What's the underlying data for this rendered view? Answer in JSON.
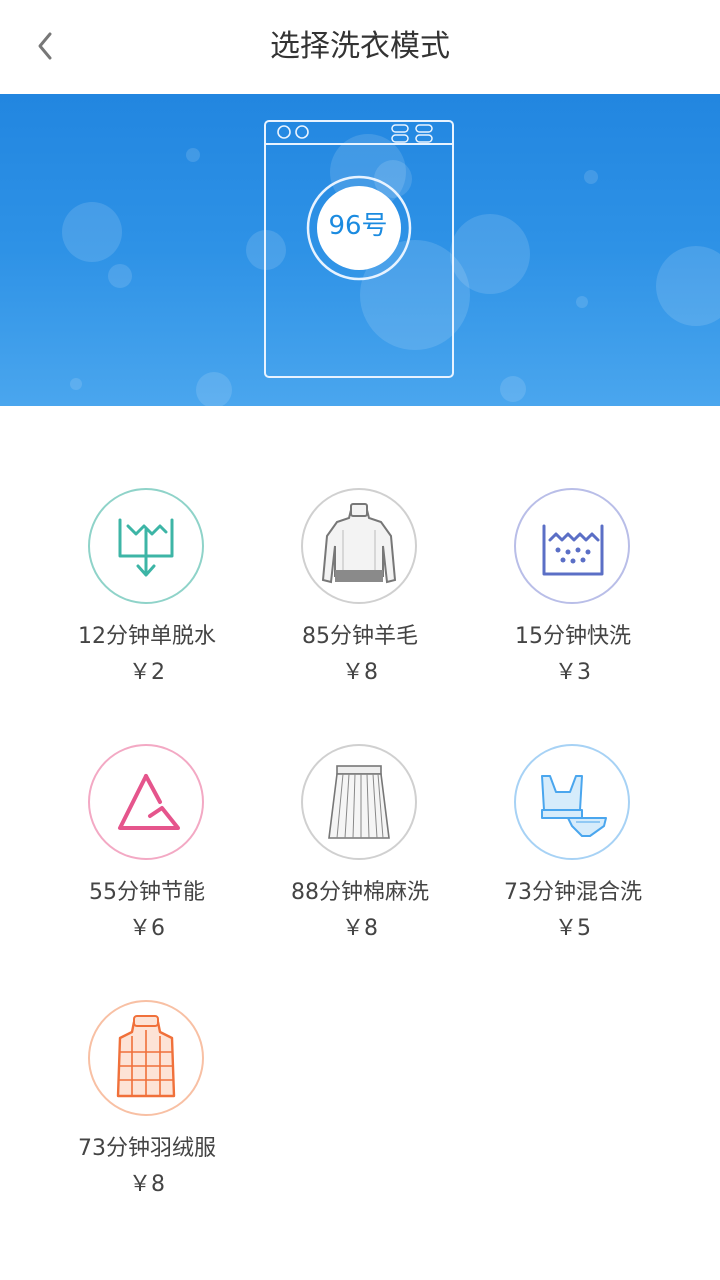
{
  "header": {
    "title": "选择洗衣模式",
    "back_icon": "chevron-left-icon"
  },
  "banner": {
    "machine_number": "96号",
    "gradient_colors": [
      "#2286e0",
      "#4aa6ee"
    ]
  },
  "modes": [
    {
      "name": "12分钟单脱水",
      "price": "￥2",
      "icon": "spin-dry-icon",
      "color": "#3db5a6"
    },
    {
      "name": "85分钟羊毛",
      "price": "￥8",
      "icon": "wool-sweater-icon",
      "color": "#7a7a7a"
    },
    {
      "name": "15分钟快洗",
      "price": "￥3",
      "icon": "quick-wash-icon",
      "color": "#5b6fc6"
    },
    {
      "name": "55分钟节能",
      "price": "￥6",
      "icon": "energy-saving-icon",
      "color": "#e5558c"
    },
    {
      "name": "88分钟棉麻洗",
      "price": "￥8",
      "icon": "skirt-icon",
      "color": "#7a7a7a"
    },
    {
      "name": "73分钟混合洗",
      "price": "￥5",
      "icon": "underwear-icon",
      "color": "#4aa6ee"
    },
    {
      "name": "73分钟羽绒服",
      "price": "￥8",
      "icon": "down-vest-icon",
      "color": "#f0703a"
    }
  ]
}
